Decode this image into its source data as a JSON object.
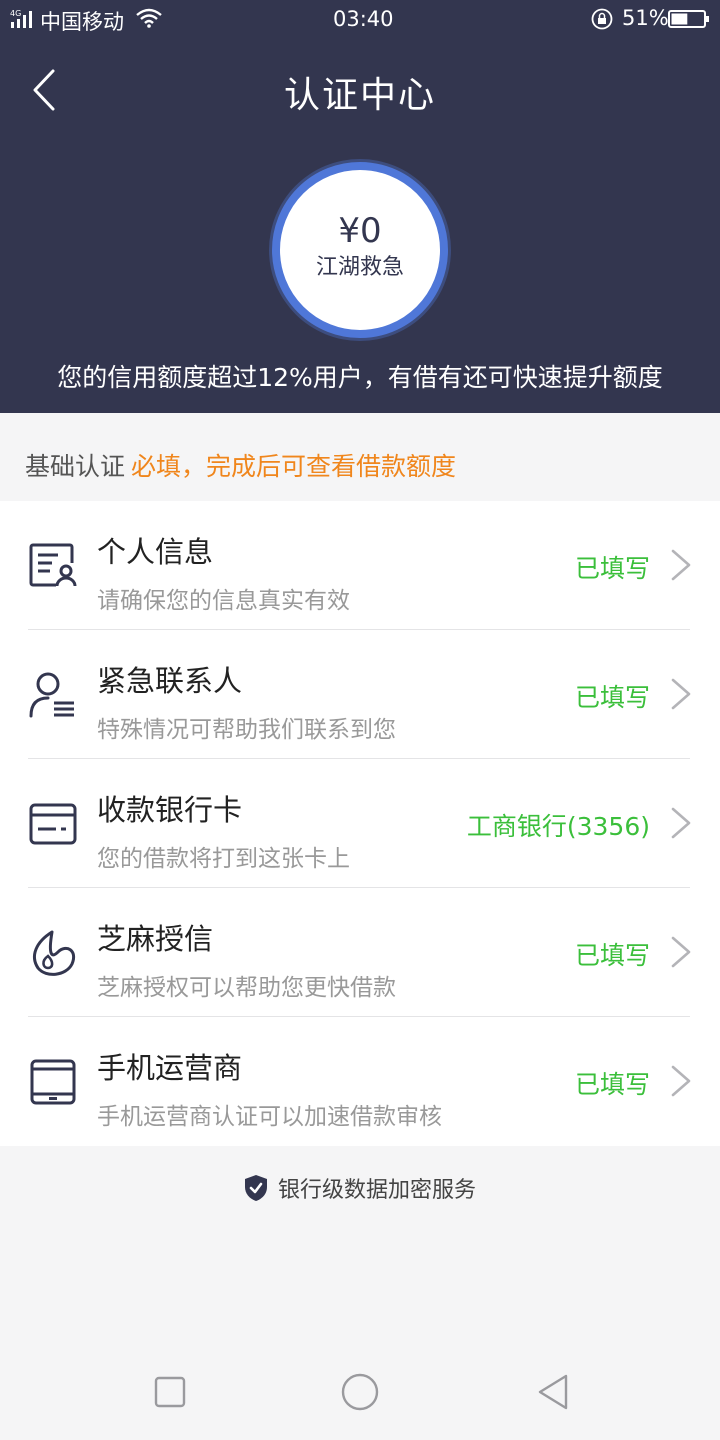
{
  "status_bar": {
    "network": "4G",
    "carrier": "中国移动",
    "time": "03:40",
    "battery": "51%",
    "battery_level": 0.51
  },
  "header": {
    "title": "认证中心",
    "back_icon": "chevron-left-icon"
  },
  "credit": {
    "amount": "¥0",
    "product": "江湖救急",
    "subtitle": "您的信用额度超过12%用户，有借有还可快速提升额度"
  },
  "section": {
    "title": "基础认证",
    "note": "必填，完成后可查看借款额度"
  },
  "items": [
    {
      "title": "个人信息",
      "desc": "请确保您的信息真实有效",
      "status": "已填写",
      "icon": "id-card-icon"
    },
    {
      "title": "紧急联系人",
      "desc": "特殊情况可帮助我们联系到您",
      "status": "已填写",
      "icon": "contact-person-icon"
    },
    {
      "title": "收款银行卡",
      "desc": "您的借款将打到这张卡上",
      "status": "工商银行(3356)",
      "icon": "bank-card-icon"
    },
    {
      "title": "芝麻授信",
      "desc": "芝麻授权可以帮助您更快借款",
      "status": "已填写",
      "icon": "sesame-icon"
    },
    {
      "title": "手机运营商",
      "desc": "手机运营商认证可以加速借款审核",
      "status": "已填写",
      "icon": "tablet-icon"
    }
  ],
  "footer": {
    "security_text": "银行级数据加密服务"
  },
  "colors": {
    "header_bg": "#33364f",
    "ring": "#4f77d8",
    "status_green": "#3bbf3b",
    "note_orange": "#f0861c"
  }
}
